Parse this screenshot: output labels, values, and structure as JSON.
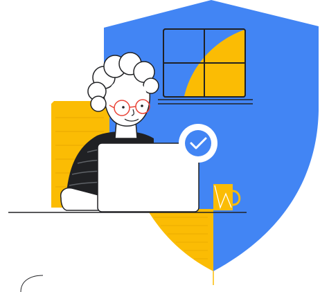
{
  "illustration": {
    "subject": "person-at-laptop-with-security-shield",
    "icons": {
      "shield": "shield-icon",
      "check": "check-icon",
      "window": "window-icon",
      "mug": "mug-icon",
      "laptop": "laptop-icon"
    }
  },
  "colors": {
    "shield_blue": "#4285f4",
    "accent_yellow": "#fbbc04",
    "stroke_dark": "#202124",
    "glasses_red": "#e94235",
    "white": "#ffffff",
    "sweater_dark": "#202124"
  }
}
